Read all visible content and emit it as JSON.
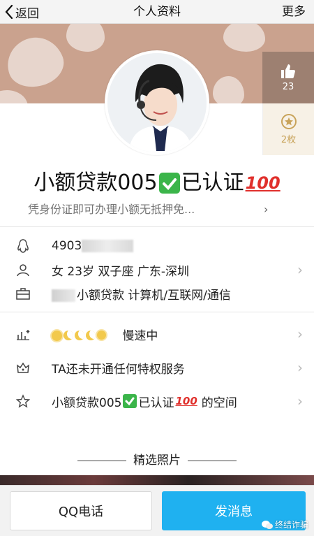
{
  "nav": {
    "back_label": "返回",
    "title": "个人资料",
    "more_label": "更多"
  },
  "side": {
    "like_count": "23",
    "medal_count": "2枚"
  },
  "profile": {
    "nickname_a": "小额贷款005",
    "nickname_b": "已认证",
    "hundred": "100",
    "signature": "凭身份证即可办理小额无抵押免...",
    "signature_arrow": "›"
  },
  "info": {
    "qq_number_visible": "4903",
    "basic": "女  23岁  双子座  广东-深圳",
    "job": "小额贷款  计算机/互联网/通信"
  },
  "rows": {
    "level_status": "慢速中",
    "privilege": "TA还未开通任何特权服务",
    "space_a": "小额贷款005",
    "space_b": "已认证",
    "space_hundred": "100",
    "space_suffix": "的空间"
  },
  "photos": {
    "title": "精选照片"
  },
  "buttons": {
    "call": "QQ电话",
    "message": "发消息"
  },
  "watermark": "终结诈骗",
  "colors": {
    "accent": "#1fb1f0",
    "cover": "#caa28e",
    "verified_green": "#3bb54a",
    "hundred_red": "#e0302c",
    "level_gold": "#f2c94c"
  }
}
